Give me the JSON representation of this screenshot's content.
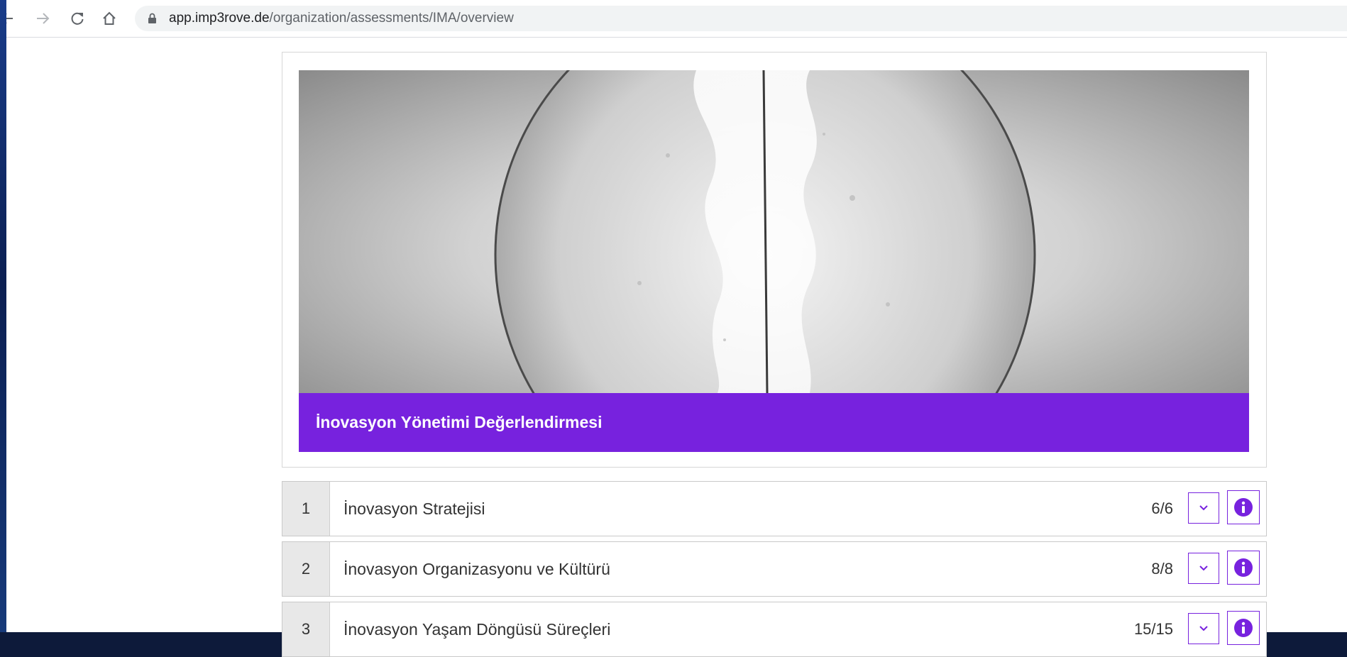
{
  "browser": {
    "url_host": "app.imp3rove.de",
    "url_path": "/organization/assessments/IMA/overview"
  },
  "hero": {
    "title": "İnovasyon Yönetimi Değerlendirmesi",
    "banner_color": "#7722de"
  },
  "sections": [
    {
      "number": "1",
      "title": "İnovasyon Stratejisi",
      "progress": "6/6"
    },
    {
      "number": "2",
      "title": "İnovasyon Organizasyonu ve Kültürü",
      "progress": "8/8"
    },
    {
      "number": "3",
      "title": "İnovasyon Yaşam Döngüsü Süreçleri",
      "progress": "15/15"
    }
  ],
  "icons": {
    "back": "arrow-left-icon",
    "forward": "arrow-right-icon",
    "reload": "reload-icon",
    "home": "home-icon",
    "lock": "lock-icon",
    "expand": "chevron-down-icon",
    "info": "info-icon"
  },
  "accent_color": "#7722de"
}
